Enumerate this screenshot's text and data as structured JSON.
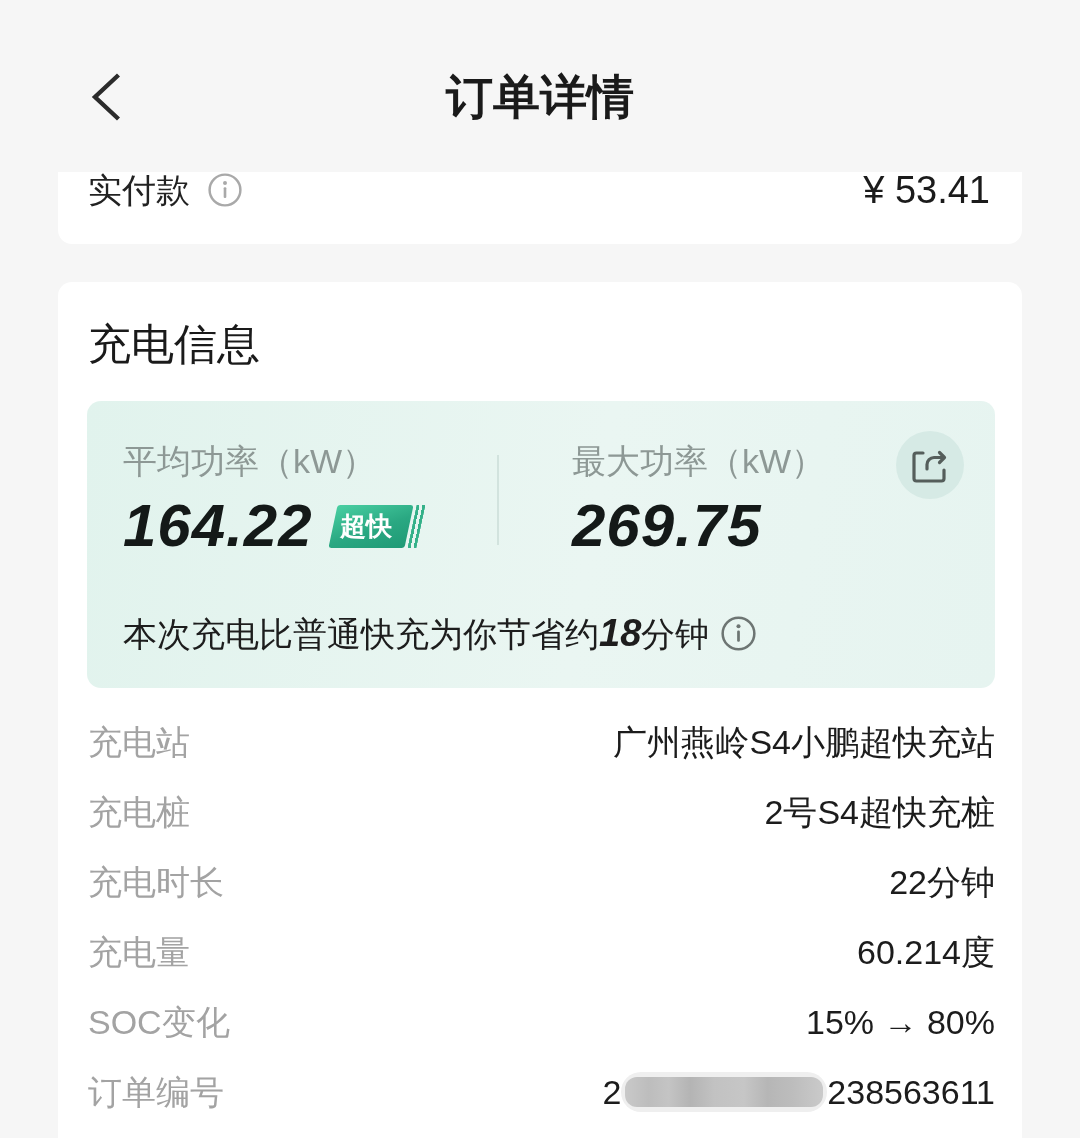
{
  "header": {
    "title": "订单详情"
  },
  "payment": {
    "label": "实付款",
    "amount": "¥ 53.41"
  },
  "charging_info": {
    "title": "充电信息",
    "power": [
      {
        "label": "平均功率（kW）",
        "value": "164.22",
        "badge": "超快"
      },
      {
        "label": "最大功率（kW）",
        "value": "269.75"
      }
    ],
    "savings": "本次充电比普通快充为你节省约**18**分钟",
    "rows": [
      {
        "label": "充电站",
        "value": "广州燕岭S4小鹏超快充站",
        "masked": false
      },
      {
        "label": "充电桩",
        "value": "2号S4超快充桩",
        "masked": false
      },
      {
        "label": "充电时长",
        "value": "22分钟",
        "masked": false
      },
      {
        "label": "充电量",
        "value": "60.214度",
        "masked": false
      },
      {
        "label": "SOC变化",
        "value": "15% → 80%",
        "masked": false
      },
      {
        "label": "订单编号",
        "value": "2",
        "masked": true,
        "value_end": "238563611"
      }
    ]
  }
}
